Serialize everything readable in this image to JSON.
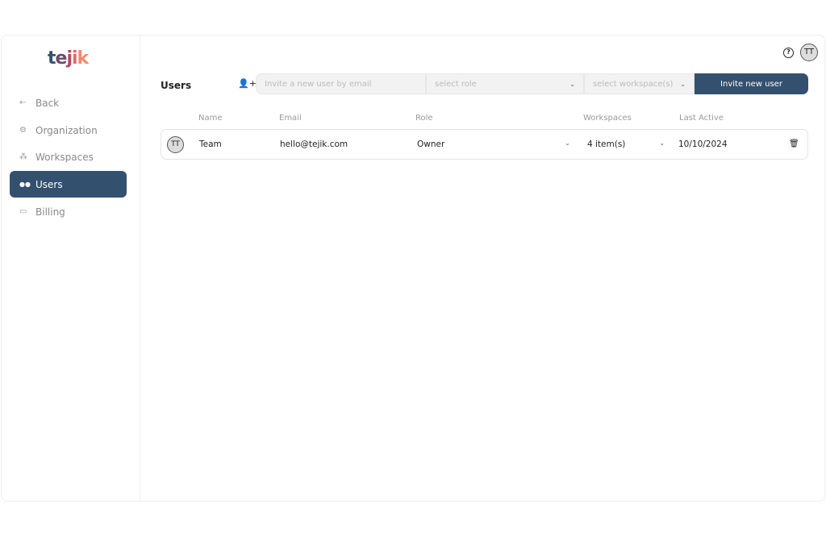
{
  "brand": {
    "logo": "tejik",
    "colors": [
      "#34506f",
      "#5a4a6e",
      "#b5495b",
      "#e06a6a",
      "#f08a70"
    ]
  },
  "sidebar": {
    "items": [
      {
        "label": "Back",
        "icon": "arrow-left-icon",
        "glyph": "←"
      },
      {
        "label": "Organization",
        "icon": "gear-icon",
        "glyph": "⚙"
      },
      {
        "label": "Workspaces",
        "icon": "nodes-icon",
        "glyph": "⁂"
      },
      {
        "label": "Users",
        "icon": "users-icon",
        "glyph": "👥",
        "active": true
      },
      {
        "label": "Billing",
        "icon": "credit-card-icon",
        "glyph": "▭"
      }
    ]
  },
  "header": {
    "help": "?",
    "avatar": "TT"
  },
  "page": {
    "title": "Users"
  },
  "invite": {
    "email_placeholder": "Invite a new user by email",
    "role_placeholder": "select role",
    "workspace_placeholder": "select workspace(s)",
    "button": "Invite new user"
  },
  "table": {
    "headers": [
      "Name",
      "Email",
      "Role",
      "Workspaces",
      "Last Active"
    ],
    "rows": [
      {
        "avatar": "TT",
        "name": "Team",
        "email": "hello@tejik.com",
        "role": "Owner",
        "workspaces": "4 item(s)",
        "last_active": "10/10/2024"
      }
    ]
  },
  "accent": "#34506f"
}
